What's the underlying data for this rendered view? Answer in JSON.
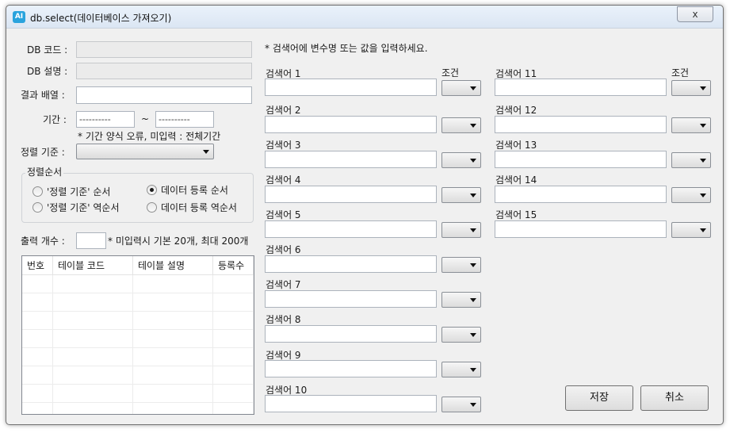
{
  "window": {
    "app_icon_text": "AI",
    "title": "db.select(데이터베이스 가져오기)",
    "close_label": "x"
  },
  "form": {
    "db_code_label": "DB 코드 :",
    "db_desc_label": "DB 설명 :",
    "result_array_label": "결과 배열 :",
    "result_array_value": "",
    "period_label": "기간 :",
    "period_start_value": "----­-­--­-­--",
    "period_tilde": "~",
    "period_end_value": "----­-­--­-­--",
    "period_note": "* 기간 양식 오류, 미입력 : 전체기간",
    "sort_label": "정렬 기준 :",
    "sort_value": ""
  },
  "sort_order": {
    "group_title": "정렬순서",
    "options": [
      {
        "label": "'정렬 기준' 순서",
        "checked": false
      },
      {
        "label": "데이터 등록 순서",
        "checked": true
      },
      {
        "label": "'정렬 기준' 역순서",
        "checked": false
      },
      {
        "label": "데이터 등록 역순서",
        "checked": false
      }
    ]
  },
  "output": {
    "count_label": "출력 개수 :",
    "count_value": "",
    "count_note": "* 미입력시 기본 20개, 최대 200개"
  },
  "table": {
    "headers": [
      "번호",
      "테이블 코드",
      "테이블 설명",
      "등록수"
    ],
    "rows": []
  },
  "search": {
    "instruction": "* 검색어에 변수명 또는 값을 입력하세요.",
    "condition_label": "조건",
    "terms": [
      {
        "label": "검색어 1",
        "value": ""
      },
      {
        "label": "검색어 2",
        "value": ""
      },
      {
        "label": "검색어 3",
        "value": ""
      },
      {
        "label": "검색어 4",
        "value": ""
      },
      {
        "label": "검색어 5",
        "value": ""
      },
      {
        "label": "검색어 6",
        "value": ""
      },
      {
        "label": "검색어 7",
        "value": ""
      },
      {
        "label": "검색어 8",
        "value": ""
      },
      {
        "label": "검색어 9",
        "value": ""
      },
      {
        "label": "검색어 10",
        "value": ""
      },
      {
        "label": "검색어 11",
        "value": ""
      },
      {
        "label": "검색어 12",
        "value": ""
      },
      {
        "label": "검색어 13",
        "value": ""
      },
      {
        "label": "검색어 14",
        "value": ""
      },
      {
        "label": "검색어 15",
        "value": ""
      }
    ]
  },
  "buttons": {
    "save": "저장",
    "cancel": "취소"
  }
}
